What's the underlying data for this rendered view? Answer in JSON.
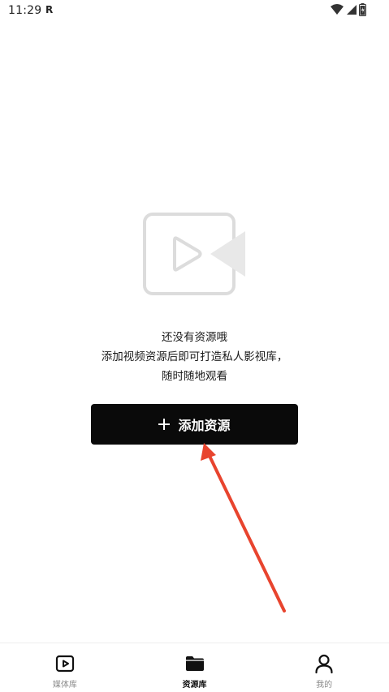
{
  "status_bar": {
    "time": "11:29",
    "carrier_badge": "R",
    "icons": [
      "wifi-icon",
      "signal-icon",
      "battery-icon"
    ]
  },
  "empty_state": {
    "illustration": "video-placeholder-icon",
    "title": "还没有资源哦",
    "description_line1": "添加视频资源后即可打造私人影视库，",
    "description_line2": "随时随地观看"
  },
  "add_button": {
    "icon": "plus-icon",
    "label": "添加资源"
  },
  "annotation": {
    "type": "arrow",
    "color": "#e8442e"
  },
  "bottom_nav": {
    "items": [
      {
        "label": "媒体库",
        "icon": "play-square-icon",
        "active": false
      },
      {
        "label": "资源库",
        "icon": "folder-icon",
        "active": true
      },
      {
        "label": "我的",
        "icon": "person-icon",
        "active": false
      }
    ]
  },
  "colors": {
    "button_bg": "#0a0a0a",
    "button_text": "#ffffff",
    "illustration": "#d8d8d8",
    "nav_active": "#111111",
    "nav_inactive": "#8a8a8a",
    "arrow": "#e8442e"
  }
}
